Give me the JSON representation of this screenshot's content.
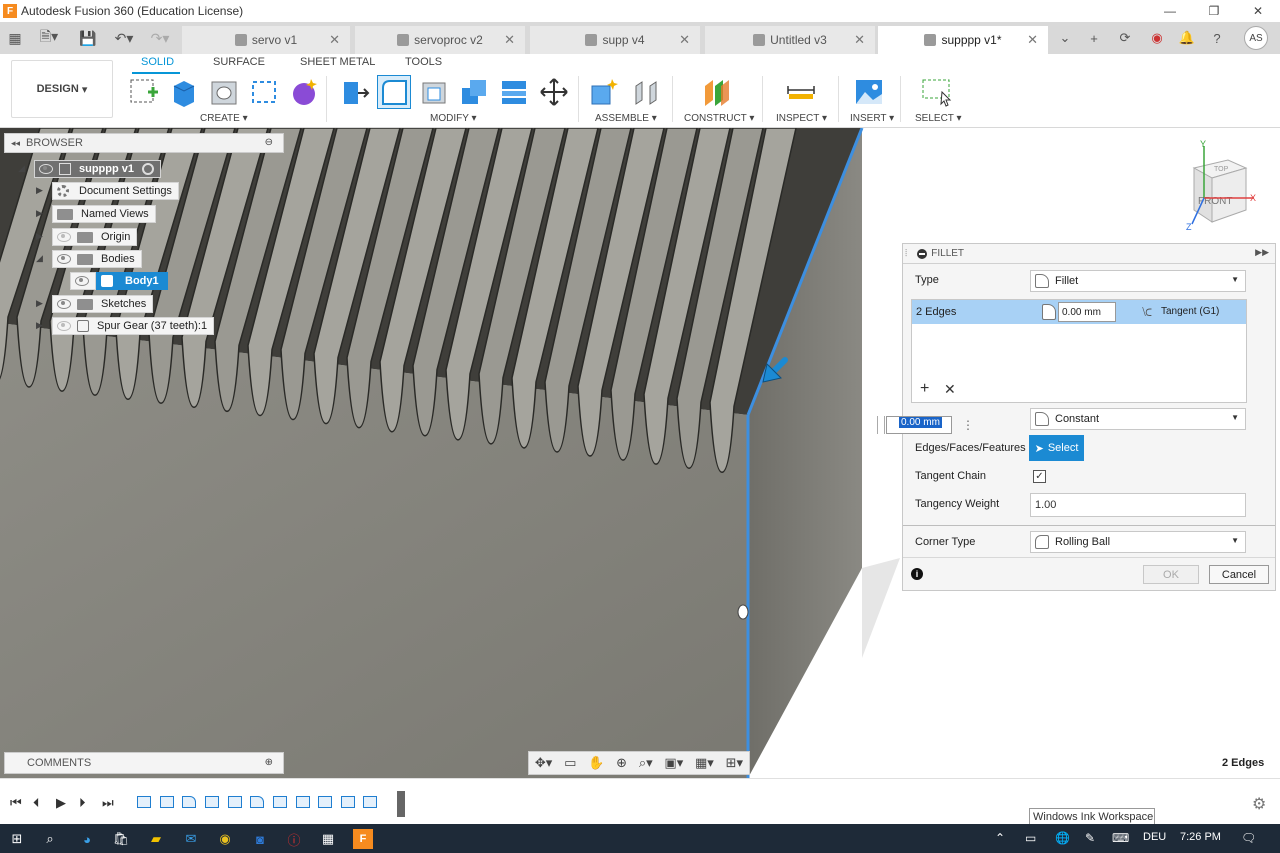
{
  "window": {
    "title": "Autodesk Fusion 360 (Education License)",
    "app_icon": "F",
    "controls": [
      "—",
      "❐",
      "✕"
    ]
  },
  "tabs": [
    {
      "label": "servo v1",
      "active": false
    },
    {
      "label": "servoproc v2",
      "active": false
    },
    {
      "label": "supp v4",
      "active": false
    },
    {
      "label": "Untitled v3",
      "active": false
    },
    {
      "label": "supppp v1*",
      "active": true
    }
  ],
  "user": {
    "initials": "AS"
  },
  "toolbar": {
    "workspace": "DESIGN",
    "workspace_tabs": [
      "SOLID",
      "SURFACE",
      "SHEET METAL",
      "TOOLS"
    ],
    "groups": [
      "CREATE",
      "MODIFY",
      "ASSEMBLE",
      "CONSTRUCT",
      "INSPECT",
      "INSERT",
      "SELECT"
    ]
  },
  "browser": {
    "title": "BROWSER",
    "root": "supppp v1",
    "items": [
      {
        "label": "Document Settings",
        "icon": "gear-icon"
      },
      {
        "label": "Named Views",
        "icon": "folder-icon"
      },
      {
        "label": "Origin",
        "icon": "folder-icon"
      },
      {
        "label": "Bodies",
        "icon": "folder-icon"
      },
      {
        "label": "Body1",
        "icon": "body-icon"
      },
      {
        "label": "Sketches",
        "icon": "folder-icon"
      },
      {
        "label": "Spur Gear (37 teeth):1",
        "icon": "component-icon"
      }
    ]
  },
  "viewcube": {
    "front": "FRONT",
    "top": "TOP",
    "axis_x": "X",
    "axis_y": "Y",
    "axis_z": "Z"
  },
  "comments": {
    "label": "COMMENTS"
  },
  "fillet": {
    "title": "FILLET",
    "type_label": "Type",
    "type_value": "Fillet",
    "edges_label": "2 Edges",
    "edge_radius": "0.00 mm",
    "edge_continuity": "Tangent (G1)",
    "radius_input": "0.00 mm",
    "radius_type": "Constant",
    "edges_faces_label": "Edges/Faces/Features",
    "select_label": "Select",
    "tangent_chain_label": "Tangent Chain",
    "tangent_chain_checked": true,
    "tangency_weight_label": "Tangency Weight",
    "tangency_weight_value": "1.00",
    "corner_type_label": "Corner Type",
    "corner_type_value": "Rolling Ball",
    "ok_label": "OK",
    "cancel_label": "Cancel"
  },
  "status": {
    "selection": "2 Edges"
  },
  "tooltip": "Windows Ink Workspace",
  "taskbar": {
    "lang": "DEU",
    "time": "7:26 PM"
  },
  "colors": {
    "accent": "#0696d7",
    "selection": "#1b8ad3",
    "model_face": "#8c8b84",
    "edge_highlight": "#3d8fe0"
  }
}
